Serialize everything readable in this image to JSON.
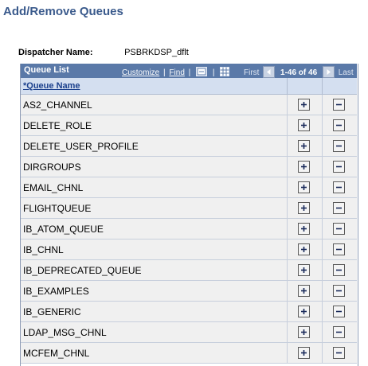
{
  "page": {
    "title": "Add/Remove Queues"
  },
  "dispatcher": {
    "label": "Dispatcher Name:",
    "value": "PSBRKDSP_dflt"
  },
  "grid": {
    "title": "Queue List",
    "customize_label": "Customize",
    "find_label": "Find",
    "first_label": "First",
    "range_label": "1-46 of 46",
    "last_label": "Last",
    "column_header": "*Queue Name",
    "rows": [
      "AS2_CHANNEL",
      "DELETE_ROLE",
      "DELETE_USER_PROFILE",
      "DIRGROUPS",
      "EMAIL_CHNL",
      "FLIGHTQUEUE",
      "IB_ATOM_QUEUE",
      "IB_CHNL",
      "IB_DEPRECATED_QUEUE",
      "IB_EXAMPLES",
      "IB_GENERIC",
      "LDAP_MSG_CHNL",
      "MCFEM_CHNL"
    ]
  },
  "icons": {
    "add_row": "plus-icon",
    "delete_row": "minus-icon",
    "view_all": "view-all-icon",
    "download": "grid-download-icon",
    "prev": "prev-arrow-icon",
    "next": "next-arrow-icon"
  },
  "colors": {
    "title_blue": "#3a5a8c",
    "grid_header": "#5a79a8",
    "column_header": "#d4dff0",
    "row_bg": "#f0f0f0"
  }
}
